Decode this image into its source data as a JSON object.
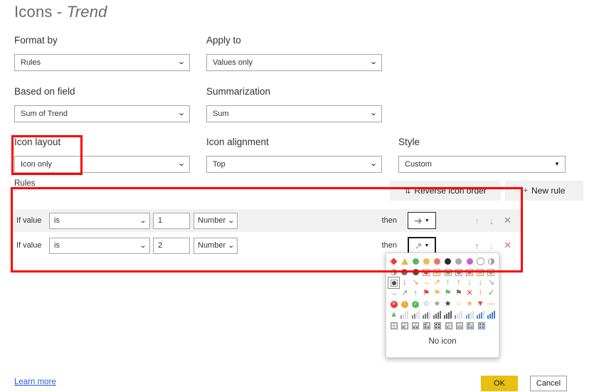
{
  "dialog": {
    "title_main": "Icons - ",
    "title_em": "Trend"
  },
  "fields": {
    "format_by": {
      "label": "Format by",
      "value": "Rules"
    },
    "apply_to": {
      "label": "Apply to",
      "value": "Values only"
    },
    "based_on_field": {
      "label": "Based on field",
      "value": "Sum of Trend"
    },
    "summarization": {
      "label": "Summarization",
      "value": "Sum"
    },
    "icon_layout": {
      "label": "Icon layout",
      "value": "Icon only"
    },
    "icon_alignment": {
      "label": "Icon alignment",
      "value": "Top"
    },
    "style": {
      "label": "Style",
      "value": "Custom"
    }
  },
  "rules": {
    "label": "Rules",
    "reverse_button": "Reverse icon order",
    "reverse_icon": "sort-order-icon",
    "new_rule_button": "New rule",
    "new_rule_icon": "plus-icon",
    "rows": [
      {
        "if_label": "If value",
        "condition": "is",
        "number": "1",
        "type": "Number",
        "then_label": "then",
        "icon": "arrow-right-icon",
        "icon_glyph": "➜",
        "move_up": "↑",
        "move_down": "↓",
        "delete": "✕"
      },
      {
        "if_label": "If value",
        "condition": "is",
        "number": "2",
        "type": "Number",
        "then_label": "then",
        "icon": "arrow-up-right-icon",
        "icon_glyph": "↗",
        "move_up": "↑",
        "move_down": "↓",
        "delete": "✕"
      }
    ]
  },
  "icon_picker": {
    "no_icon_label": "No icon",
    "rows": [
      [
        {
          "name": "red-diamond-icon",
          "shape": "dia",
          "color": "#ee3b2f"
        },
        {
          "name": "orange-triangle-icon",
          "shape": "tri",
          "color": "#f5b335"
        },
        {
          "name": "green-circle-icon",
          "shape": "ci",
          "color": "#5cb85c"
        },
        {
          "name": "yellow-circle-icon",
          "shape": "ci",
          "color": "#f0bc50"
        },
        {
          "name": "salmon-circle-icon",
          "shape": "ci",
          "color": "#f4705f"
        },
        {
          "name": "black-circle-icon",
          "shape": "ci",
          "color": "#2b2b2b"
        },
        {
          "name": "gray-circle-icon",
          "shape": "ci",
          "color": "#a8a8a8"
        },
        {
          "name": "magenta-circle-icon",
          "shape": "ci",
          "color": "#d159d6"
        },
        {
          "name": "white-circle-icon",
          "shape": "ci",
          "color": "#ffffff"
        },
        {
          "name": "half-circle-icon",
          "shape": "half",
          "color": "#9a9a9a"
        }
      ],
      [
        {
          "name": "quarter-circle-icon",
          "shape": "half",
          "color": "#9a9a9a"
        },
        {
          "name": "three-quarter-circle-icon",
          "shape": "ci",
          "color": "#6e6e6e"
        },
        {
          "name": "dark-circle-icon",
          "shape": "ci",
          "color": "#4a4a4a"
        },
        {
          "name": "red-traffic-light-icon",
          "shape": "tlsq",
          "color": "#ee3b2f"
        },
        {
          "name": "yellow-traffic-light-icon",
          "shape": "tlsq",
          "color": "#f0bc50"
        },
        {
          "name": "green-traffic-light-icon",
          "shape": "tlsq",
          "color": "#5cb85c"
        },
        {
          "name": "gray-traffic-light-icon",
          "shape": "tlsq",
          "color": "#8a8a8a"
        },
        {
          "name": "red-square-icon",
          "shape": "tlsq",
          "color": "#f4705f"
        },
        {
          "name": "yellow-square-icon",
          "shape": "tlsq",
          "color": "#f0bc50"
        },
        {
          "name": "green-square-icon",
          "shape": "tlsq",
          "color": "#7cc47c"
        }
      ],
      [
        {
          "name": "selected-circle-icon",
          "shape": "tlsq",
          "color": "#4a4a4a",
          "selected": true
        },
        {
          "name": "red-arrow-down-icon",
          "shape": "glyph",
          "glyph": "↓",
          "color": "#ee3b2f"
        },
        {
          "name": "orange-arrow-down-right-icon",
          "shape": "glyph",
          "glyph": "↘",
          "color": "#f0a030"
        },
        {
          "name": "orange-arrow-right-icon",
          "shape": "glyph",
          "glyph": "→",
          "color": "#f0a030"
        },
        {
          "name": "orange-arrow-up-right-icon",
          "shape": "glyph",
          "glyph": "↗",
          "color": "#f0a030"
        },
        {
          "name": "green-arrow-up-icon",
          "shape": "glyph",
          "glyph": "↑",
          "color": "#5cb85c"
        },
        {
          "name": "red-arrow-up-icon",
          "shape": "glyph",
          "glyph": "↑",
          "color": "#ee5b4f"
        },
        {
          "name": "green-arrow-down-icon",
          "shape": "glyph",
          "glyph": "↓",
          "color": "#5cb85c"
        },
        {
          "name": "gray-arrow-down-icon",
          "shape": "glyph",
          "glyph": "↓",
          "color": "#9a9a9a"
        },
        {
          "name": "gray-arrow-down-right-icon",
          "shape": "glyph",
          "glyph": "↘",
          "color": "#9a9a9a"
        }
      ],
      [
        {
          "name": "gray-arrow-right-icon",
          "shape": "glyph",
          "glyph": "→",
          "color": "#8a8a8a"
        },
        {
          "name": "gray-arrow-up-right-icon",
          "shape": "glyph",
          "glyph": "↗",
          "color": "#8a8a8a"
        },
        {
          "name": "gray-arrow-up-icon",
          "shape": "glyph",
          "glyph": "↑",
          "color": "#8a8a8a"
        },
        {
          "name": "red-flag-icon",
          "shape": "glyph",
          "glyph": "⚑",
          "color": "#ee3b2f"
        },
        {
          "name": "yellow-flag-icon",
          "shape": "glyph",
          "glyph": "⚑",
          "color": "#f0bc50"
        },
        {
          "name": "green-flag-icon",
          "shape": "glyph",
          "glyph": "⚑",
          "color": "#5cb85c"
        },
        {
          "name": "gray-flag-icon",
          "shape": "glyph",
          "glyph": "⚑",
          "color": "#6e6e6e"
        },
        {
          "name": "red-cross-icon",
          "shape": "glyph",
          "glyph": "✕",
          "color": "#ee3b2f"
        },
        {
          "name": "orange-exclamation-icon",
          "shape": "glyph",
          "glyph": "!",
          "color": "#f0a030"
        },
        {
          "name": "green-check-icon",
          "shape": "glyph",
          "glyph": "✓",
          "color": "#3faa3f"
        }
      ],
      [
        {
          "name": "red-cross-circle-icon",
          "shape": "badge",
          "glyph": "✕",
          "color": "#ee3b2f"
        },
        {
          "name": "orange-exclamation-circle-icon",
          "shape": "badge",
          "glyph": "!",
          "color": "#f0a838"
        },
        {
          "name": "green-check-circle-icon",
          "shape": "badge",
          "glyph": "✓",
          "color": "#5cb85c"
        },
        {
          "name": "gray-star-outline-icon",
          "shape": "glyph",
          "glyph": "☆",
          "color": "#6e6e6e"
        },
        {
          "name": "gray-star-half-icon",
          "shape": "glyph",
          "glyph": "★",
          "color": "#9a9a9a"
        },
        {
          "name": "gray-star-filled-icon",
          "shape": "glyph",
          "glyph": "★",
          "color": "#3a3a3a"
        },
        {
          "name": "gold-star-outline-icon",
          "shape": "glyph",
          "glyph": "☆",
          "color": "#f0bc50"
        },
        {
          "name": "gold-star-filled-icon",
          "shape": "glyph",
          "glyph": "★",
          "color": "#f0bc50"
        },
        {
          "name": "red-triangle-down-icon",
          "shape": "glyph",
          "glyph": "▼",
          "color": "#ee3b2f"
        },
        {
          "name": "orange-dash-icon",
          "shape": "glyph",
          "glyph": "—",
          "color": "#f0a030"
        }
      ],
      [
        {
          "name": "green-triangle-up-icon",
          "shape": "glyph",
          "glyph": "▲",
          "color": "#5cb85c"
        },
        {
          "name": "signal-bars-1-icon",
          "shape": "bars",
          "color": "#9a9a9a",
          "filled": 1
        },
        {
          "name": "signal-bars-2-icon",
          "shape": "bars",
          "color": "#8a8a8a",
          "filled": 2
        },
        {
          "name": "signal-bars-3-icon",
          "shape": "bars",
          "color": "#7a7a7a",
          "filled": 3
        },
        {
          "name": "signal-bars-4-icon",
          "shape": "bars",
          "color": "#6a6a6a",
          "filled": 4
        },
        {
          "name": "signal-bars-full-icon",
          "shape": "bars",
          "color": "#5a5a5a",
          "filled": 4
        },
        {
          "name": "signal-bars-blue-1-icon",
          "shape": "bars",
          "color": "#6aa0d8",
          "filled": 1
        },
        {
          "name": "signal-bars-blue-2-icon",
          "shape": "bars",
          "color": "#6aa0d8",
          "filled": 2
        },
        {
          "name": "signal-bars-blue-3-icon",
          "shape": "bars",
          "color": "#4a8fd0",
          "filled": 3
        },
        {
          "name": "signal-bars-blue-4-icon",
          "shape": "bars",
          "color": "#3a80c8",
          "filled": 4
        }
      ],
      [
        {
          "name": "quadrant-empty-icon",
          "shape": "quad",
          "color": "#ffffff",
          "fills": [
            0,
            0,
            0,
            0
          ]
        },
        {
          "name": "quadrant-one-icon",
          "shape": "quad",
          "color": "#6e6e6e",
          "fills": [
            0,
            0,
            1,
            0
          ]
        },
        {
          "name": "quadrant-two-icon",
          "shape": "quad",
          "color": "#6e6e6e",
          "fills": [
            0,
            0,
            1,
            1
          ]
        },
        {
          "name": "quadrant-three-icon",
          "shape": "quad",
          "color": "#6e6e6e",
          "fills": [
            1,
            0,
            1,
            1
          ]
        },
        {
          "name": "quadrant-four-icon",
          "shape": "quad",
          "color": "#4a4a4a",
          "fills": [
            1,
            1,
            1,
            1
          ]
        },
        {
          "name": "quadrant-blue-one-icon",
          "shape": "quad",
          "color": "#6aa0d8",
          "fills": [
            0,
            0,
            1,
            0
          ]
        },
        {
          "name": "quadrant-blue-two-icon",
          "shape": "quad",
          "color": "#6aa0d8",
          "fills": [
            0,
            0,
            1,
            1
          ]
        },
        {
          "name": "quadrant-blue-three-icon",
          "shape": "quad",
          "color": "#4a8fd0",
          "fills": [
            1,
            0,
            1,
            1
          ]
        },
        {
          "name": "quadrant-blue-four-icon",
          "shape": "quad",
          "color": "#3a80c8",
          "fills": [
            1,
            1,
            1,
            1
          ]
        }
      ]
    ]
  },
  "footer": {
    "learn_more": "Learn more",
    "ok": "OK",
    "cancel": "Cancel"
  },
  "colors": {
    "accent_ok": "#e8c010",
    "annotation": "#ff0000",
    "link": "#2b5bd7"
  }
}
